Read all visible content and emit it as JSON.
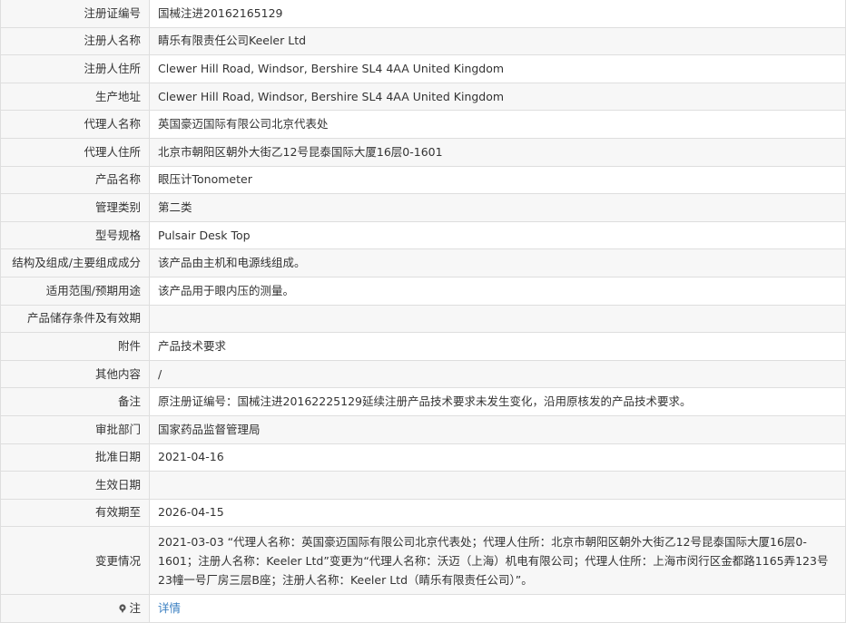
{
  "rows": [
    {
      "label": "注册证编号",
      "value": "国械注进20162165129"
    },
    {
      "label": "注册人名称",
      "value": "睛乐有限责任公司Keeler Ltd"
    },
    {
      "label": "注册人住所",
      "value": "Clewer Hill Road, Windsor, Bershire SL4 4AA United Kingdom"
    },
    {
      "label": "生产地址",
      "value": "Clewer Hill Road, Windsor, Bershire SL4 4AA United Kingdom"
    },
    {
      "label": "代理人名称",
      "value": "英国豪迈国际有限公司北京代表处"
    },
    {
      "label": "代理人住所",
      "value": "北京市朝阳区朝外大街乙12号昆泰国际大厦16层0-1601"
    },
    {
      "label": "产品名称",
      "value": "眼压计Tonometer"
    },
    {
      "label": "管理类别",
      "value": "第二类"
    },
    {
      "label": "型号规格",
      "value": "Pulsair Desk Top"
    },
    {
      "label": "结构及组成/主要组成成分",
      "value": "该产品由主机和电源线组成。"
    },
    {
      "label": "适用范围/预期用途",
      "value": "该产品用于眼内压的测量。"
    },
    {
      "label": "产品储存条件及有效期",
      "value": ""
    },
    {
      "label": "附件",
      "value": "产品技术要求"
    },
    {
      "label": "其他内容",
      "value": "/"
    },
    {
      "label": "备注",
      "value": "原注册证编号：国械注进20162225129延续注册产品技术要求未发生变化，沿用原核发的产品技术要求。"
    },
    {
      "label": "审批部门",
      "value": "国家药品监督管理局"
    },
    {
      "label": "批准日期",
      "value": "2021-04-16"
    },
    {
      "label": "生效日期",
      "value": ""
    },
    {
      "label": "有效期至",
      "value": "2026-04-15"
    },
    {
      "label": "变更情况",
      "value": "2021-03-03 “代理人名称：英国豪迈国际有限公司北京代表处；代理人住所：北京市朝阳区朝外大街乙12号昆泰国际大厦16层0-1601；注册人名称：Keeler Ltd”变更为“代理人名称：沃迈（上海）机电有限公司；代理人住所：上海市闵行区金都路1165弄123号23幢一号厂房三层B座；注册人名称：Keeler Ltd（睛乐有限责任公司）”。"
    }
  ],
  "note": {
    "label": "注",
    "link": "详情",
    "icon": "pin-icon",
    "link_color": "#3a7fc1"
  }
}
